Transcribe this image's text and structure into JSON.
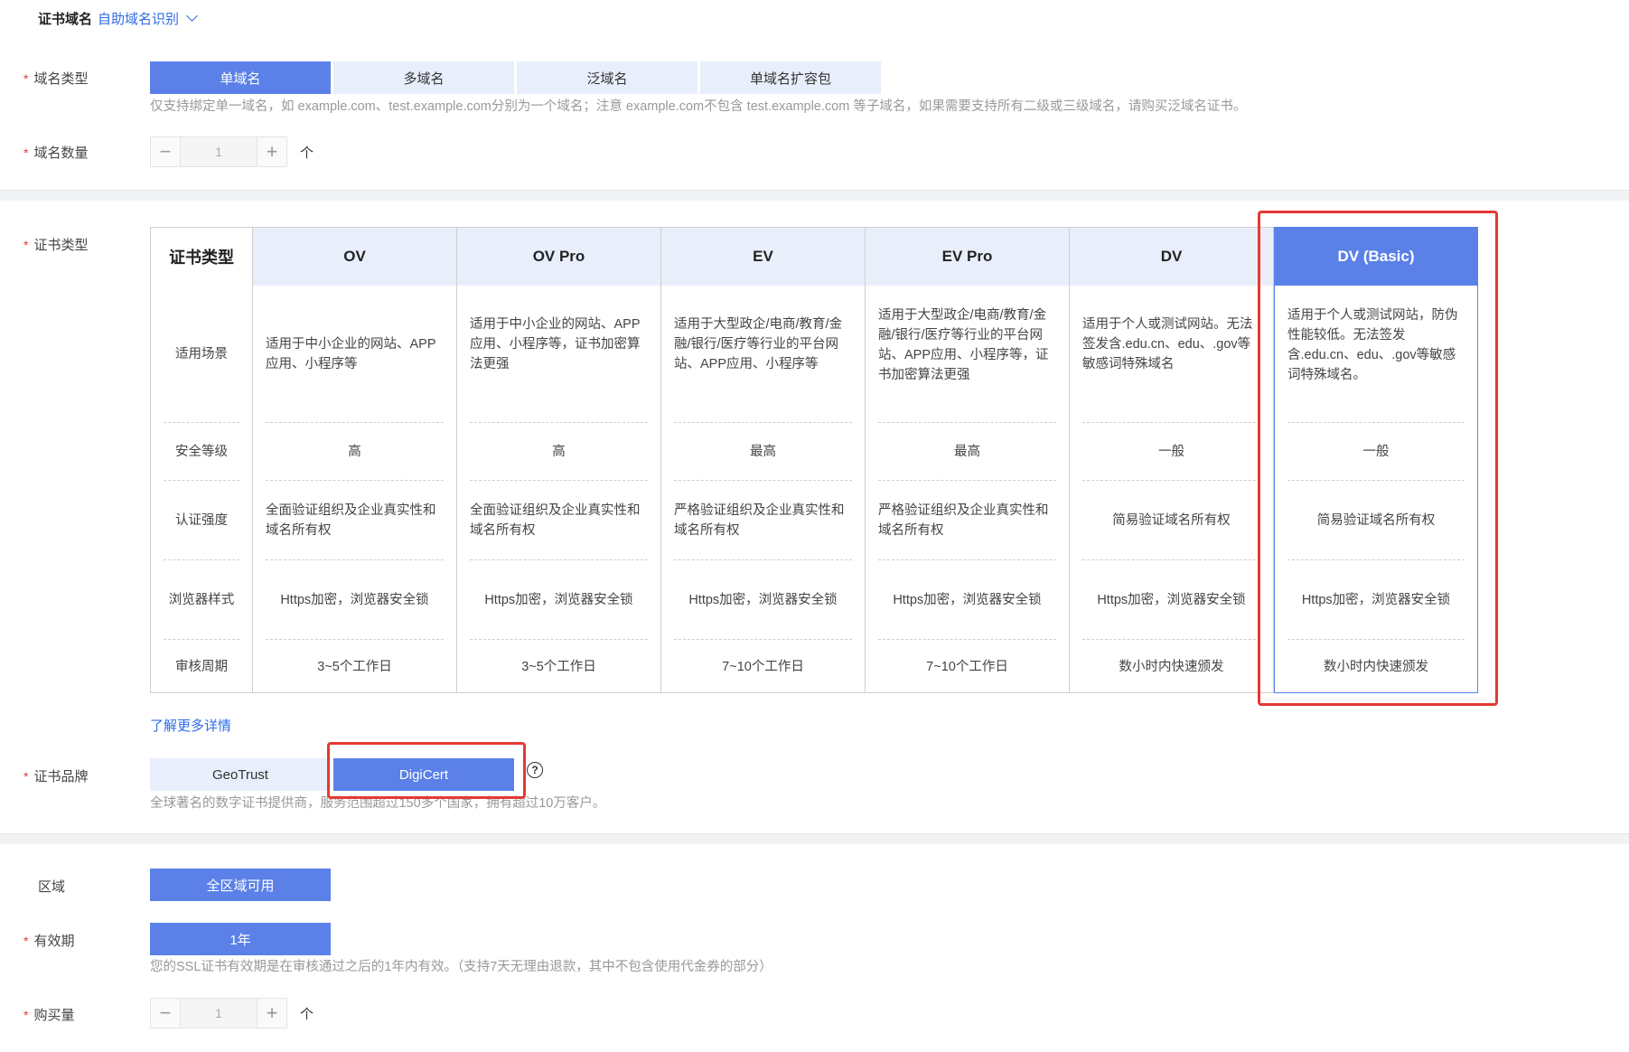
{
  "cert_domain": {
    "title": "证书域名",
    "auto_detect_link": "自助域名识别"
  },
  "domain_type": {
    "label": "域名类型",
    "options": [
      "单域名",
      "多域名",
      "泛域名",
      "单域名扩容包"
    ],
    "selected": "单域名",
    "hint": "仅支持绑定单一域名，如 example.com、test.example.com分别为一个域名；注意 example.com不包含 test.example.com 等子域名，如果需要支持所有二级或三级域名，请购买泛域名证书。"
  },
  "domain_count": {
    "label": "域名数量",
    "value": "1",
    "unit": "个",
    "minus": "−",
    "plus": "+"
  },
  "cert_type": {
    "label": "证书类型",
    "header_label": "证书类型",
    "row_labels": [
      "适用场景",
      "安全等级",
      "认证强度",
      "浏览器样式",
      "审核周期"
    ],
    "columns": [
      {
        "name": "OV",
        "scenario": "适用于中小企业的网站、APP应用、小程序等",
        "security": "高",
        "auth": "全面验证组织及企业真实性和域名所有权",
        "browser": "Https加密，浏览器安全锁",
        "review": "3~5个工作日"
      },
      {
        "name": "OV Pro",
        "scenario": "适用于中小企业的网站、APP应用、小程序等，证书加密算法更强",
        "security": "高",
        "auth": "全面验证组织及企业真实性和域名所有权",
        "browser": "Https加密，浏览器安全锁",
        "review": "3~5个工作日"
      },
      {
        "name": "EV",
        "scenario": "适用于大型政企/电商/教育/金融/银行/医疗等行业的平台网站、APP应用、小程序等",
        "security": "最高",
        "auth": "严格验证组织及企业真实性和域名所有权",
        "browser": "Https加密，浏览器安全锁",
        "review": "7~10个工作日"
      },
      {
        "name": "EV Pro",
        "scenario": "适用于大型政企/电商/教育/金融/银行/医疗等行业的平台网站、APP应用、小程序等，证书加密算法更强",
        "security": "最高",
        "auth": "严格验证组织及企业真实性和域名所有权",
        "browser": "Https加密，浏览器安全锁",
        "review": "7~10个工作日"
      },
      {
        "name": "DV",
        "scenario": "适用于个人或测试网站。无法签发含.edu.cn、edu、.gov等敏感词特殊域名",
        "security": "一般",
        "auth": "简易验证域名所有权",
        "browser": "Https加密，浏览器安全锁",
        "review": "数小时内快速颁发"
      },
      {
        "name": "DV (Basic)",
        "scenario": "适用于个人或测试网站，防伪性能较低。无法签发含.edu.cn、edu、.gov等敏感词特殊域名。",
        "security": "一般",
        "auth": "简易验证域名所有权",
        "browser": "Https加密，浏览器安全锁",
        "review": "数小时内快速颁发"
      }
    ],
    "selected": "DV (Basic)",
    "learn_more": "了解更多详情"
  },
  "cert_brand": {
    "label": "证书品牌",
    "options": [
      "GeoTrust",
      "DigiCert"
    ],
    "selected": "DigiCert",
    "help": "?",
    "hint": "全球著名的数字证书提供商，服务范围超过150多个国家，拥有超过10万客户。"
  },
  "region": {
    "label": "区域",
    "value": "全区域可用"
  },
  "validity": {
    "label": "有效期",
    "value": "1年",
    "hint": "您的SSL证书有效期是在审核通过之后的1年内有效。（支持7天无理由退款，其中不包含使用代金券的部分）"
  },
  "purchase_qty": {
    "label": "购买量",
    "value": "1",
    "unit": "个",
    "minus": "−",
    "plus": "+"
  },
  "colors": {
    "accent": "#5b80e8",
    "link": "#2e6be6",
    "required": "#e53935",
    "highlight_box": "#e53935"
  }
}
